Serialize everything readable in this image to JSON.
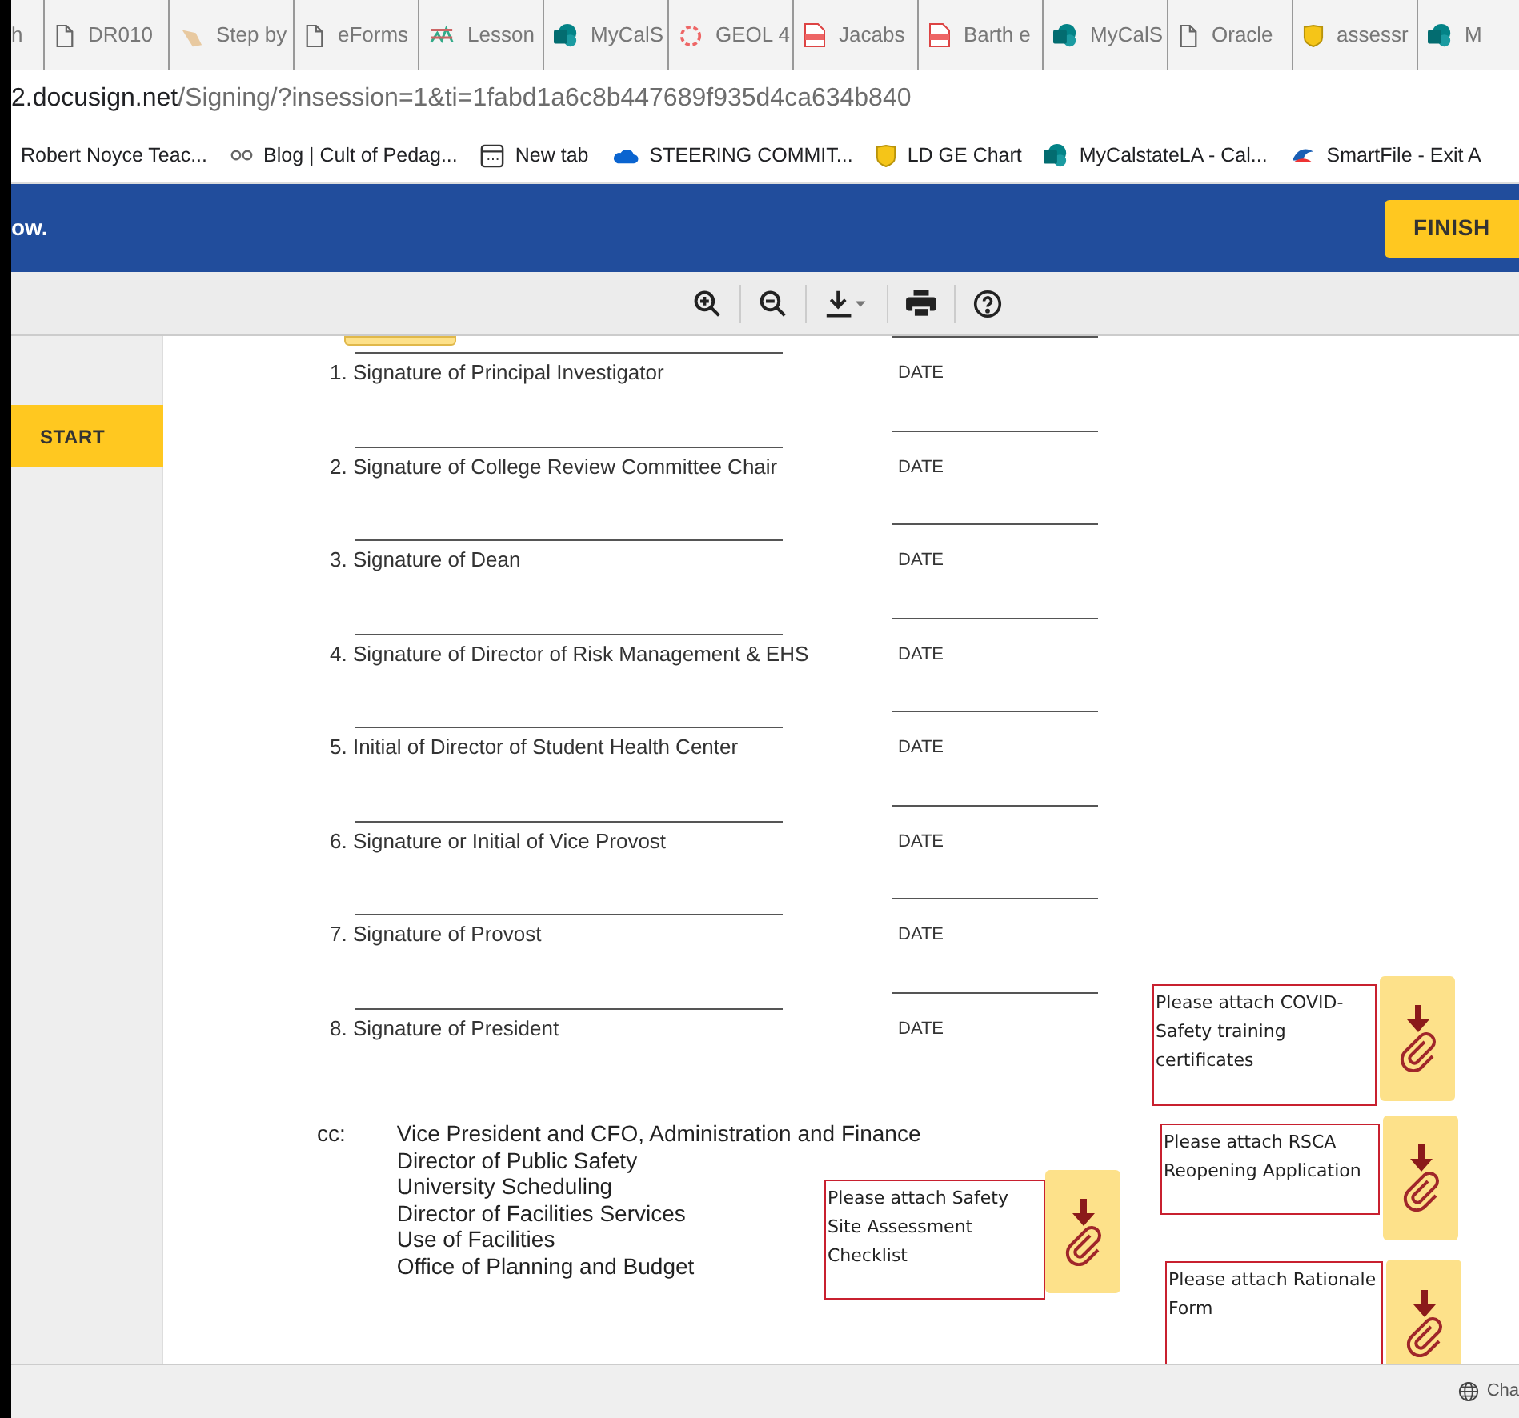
{
  "tabs": [
    {
      "label": "h"
    },
    {
      "label": "DR010"
    },
    {
      "label": "Step by"
    },
    {
      "label": "eForms"
    },
    {
      "label": "Lesson"
    },
    {
      "label": "MyCalS"
    },
    {
      "label": "GEOL 4"
    },
    {
      "label": "Jacabs"
    },
    {
      "label": "Barth e"
    },
    {
      "label": "MyCalS"
    },
    {
      "label": "Oracle"
    },
    {
      "label": "assessr"
    },
    {
      "label": "M"
    }
  ],
  "address": {
    "host": "2.docusign.net",
    "path": "/Signing/?insession=1&ti=1fabd1a6c8b447689f935d4ca634b840"
  },
  "bookmarks": [
    {
      "label": "Robert Noyce Teac..."
    },
    {
      "label": "Blog | Cult of Pedag..."
    },
    {
      "label": "New tab"
    },
    {
      "label": "STEERING COMMIT..."
    },
    {
      "label": "LD GE Chart"
    },
    {
      "label": "MyCalstateLA - Cal..."
    },
    {
      "label": "SmartFile - Exit A"
    }
  ],
  "header": {
    "message": "ow.",
    "finish": "FINISH"
  },
  "start": "START",
  "signatures": [
    {
      "label": "1. Signature of Principal Investigator",
      "date": "DATE"
    },
    {
      "label": "2. Signature of College Review Committee Chair",
      "date": "DATE"
    },
    {
      "label": "3. Signature of Dean",
      "date": "DATE"
    },
    {
      "label": "4. Signature of Director of Risk Management & EHS",
      "date": "DATE"
    },
    {
      "label": "5. Initial of Director of Student Health Center",
      "date": "DATE"
    },
    {
      "label": "6. Signature or Initial of Vice Provost",
      "date": "DATE"
    },
    {
      "label": "7. Signature of Provost",
      "date": "DATE"
    },
    {
      "label": "8. Signature of President",
      "date": "DATE"
    }
  ],
  "cc": {
    "label": "cc:",
    "lines": [
      "Vice President and CFO, Administration and Finance",
      "Director of Public Safety",
      "University Scheduling",
      "Director of Facilities Services",
      "Use of Facilities",
      "Office of Planning and Budget"
    ]
  },
  "attachments": [
    {
      "text": "Please attach COVID-Safety training certificates"
    },
    {
      "text": "Please attach RSCA Reopening Application"
    },
    {
      "text": "Please attach Safety Site Assessment Checklist"
    },
    {
      "text": "Please attach Rationale Form"
    }
  ],
  "footer": {
    "language": "Cha"
  }
}
